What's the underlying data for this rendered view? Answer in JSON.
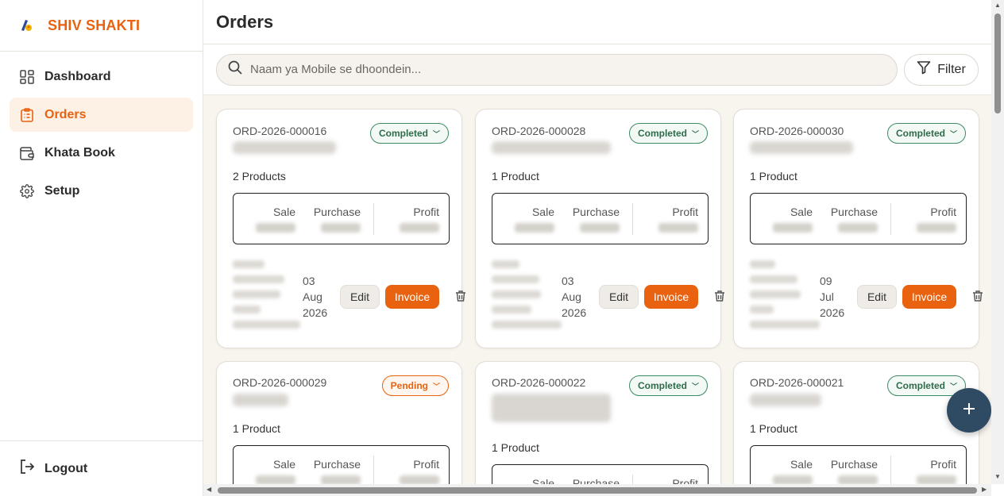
{
  "brand": {
    "name": "SHIV SHAKTI"
  },
  "sidebar": {
    "items": [
      {
        "label": "Dashboard",
        "icon": "grid-icon",
        "active": false
      },
      {
        "label": "Orders",
        "icon": "clipboard-icon",
        "active": true
      },
      {
        "label": "Khata Book",
        "icon": "wallet-icon",
        "active": false
      },
      {
        "label": "Setup",
        "icon": "gear-icon",
        "active": false
      }
    ],
    "logout_label": "Logout"
  },
  "header": {
    "title": "Orders"
  },
  "search": {
    "placeholder": "Naam ya Mobile se dhoondein..."
  },
  "filter": {
    "label": "Filter"
  },
  "labels": {
    "sale": "Sale",
    "purchase": "Purchase",
    "profit": "Profit",
    "edit": "Edit",
    "invoice": "Invoice"
  },
  "orders": [
    {
      "id": "ORD-2026-000016",
      "status": "Completed",
      "products": "2 Products",
      "date_line1": "03",
      "date_line2": "Aug",
      "date_line3": "2026"
    },
    {
      "id": "ORD-2026-000028",
      "status": "Completed",
      "products": "1 Product",
      "date_line1": "03",
      "date_line2": "Aug",
      "date_line3": "2026"
    },
    {
      "id": "ORD-2026-000030",
      "status": "Completed",
      "products": "1 Product",
      "date_line1": "09",
      "date_line2": "Jul",
      "date_line3": "2026"
    },
    {
      "id": "ORD-2026-000029",
      "status": "Pending",
      "products": "1 Product"
    },
    {
      "id": "ORD-2026-000022",
      "status": "Completed",
      "products": "1 Product"
    },
    {
      "id": "ORD-2026-000021",
      "status": "Completed",
      "products": "1 Product"
    }
  ],
  "colors": {
    "accent": "#e8620f",
    "fab": "#2f4a63",
    "completed": "#2f6b4b"
  }
}
